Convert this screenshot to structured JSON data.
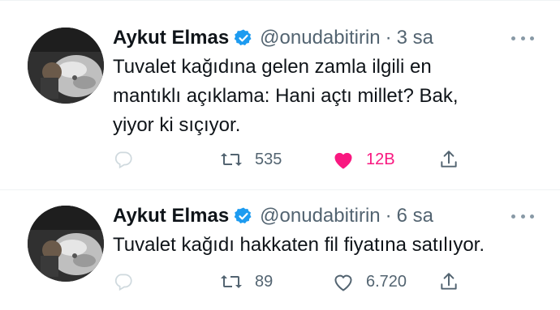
{
  "tweets": [
    {
      "author_name": "Aykut Elmas",
      "handle": "@onudabitirin",
      "separator": "·",
      "time": "3 sa",
      "text_lines": [
        "Tuvalet kağıdına gelen zamla ilgili en",
        "mantıklı açıklama: Hani açtı millet? Bak,",
        "yiyor ki sıçıyor."
      ],
      "replies": "",
      "retweets": "535",
      "likes": "12B",
      "liked": true
    },
    {
      "author_name": "Aykut Elmas",
      "handle": "@onudabitirin",
      "separator": "·",
      "time": "6 sa",
      "text_lines": [
        "Tuvalet kağıdı hakkaten fil fiyatına satılıyor."
      ],
      "replies": "",
      "retweets": "89",
      "likes": "6.720",
      "liked": false
    }
  ],
  "colors": {
    "verified_badge": "#1d9bf0",
    "like_active": "#f91880",
    "secondary_text": "#536471",
    "divider": "#eff3f4"
  },
  "icons": [
    "verified-icon",
    "more-icon",
    "reply-icon",
    "retweet-icon",
    "heart-icon",
    "share-icon"
  ]
}
